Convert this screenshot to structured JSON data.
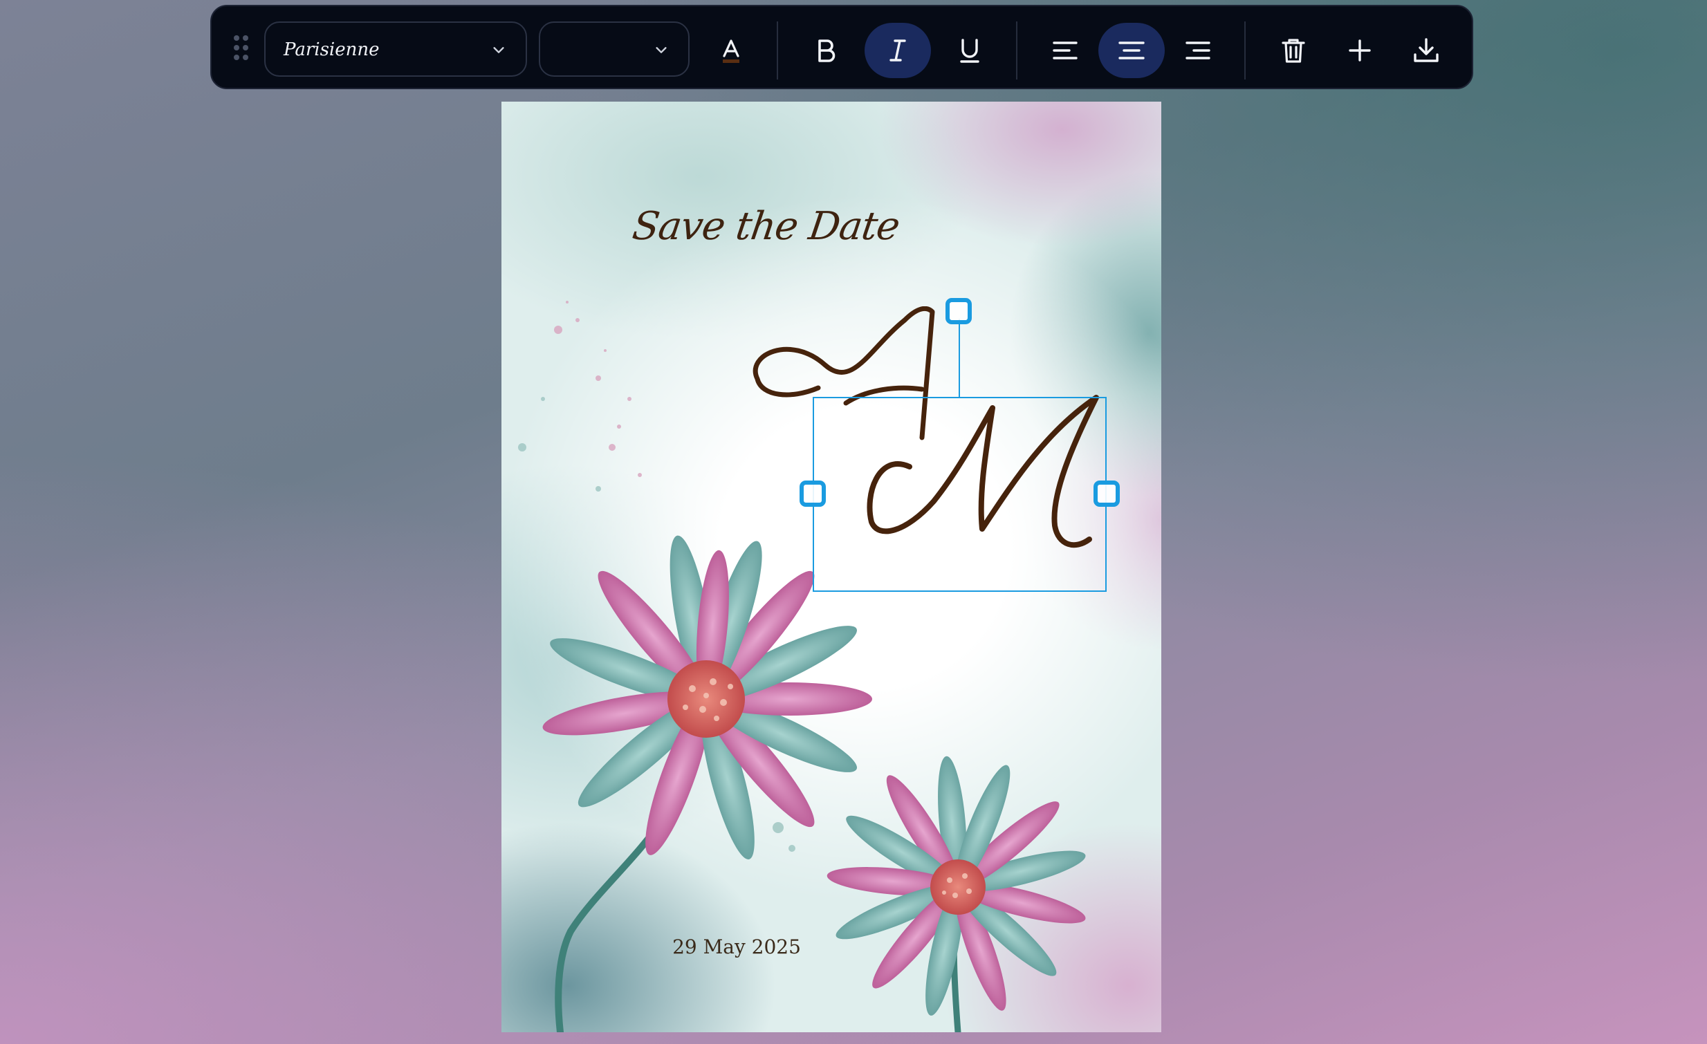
{
  "toolbar": {
    "font_family_value": "Parisienne",
    "font_size_value": "",
    "buttons": {
      "text_color": "text-color-icon",
      "bold": "bold-icon",
      "italic": "italic-icon",
      "underline": "underline-icon",
      "align_left": "align-left-icon",
      "align_center": "align-center-icon",
      "align_right": "align-right-icon",
      "delete": "trash-icon",
      "add": "plus-icon",
      "download": "download-icon"
    },
    "active": [
      "italic",
      "align_center"
    ],
    "text_color": "#5a2e12",
    "accent": "#1a2a5e"
  },
  "card": {
    "heading": "Save the Date",
    "monogram_first": "A",
    "monogram_second": "M",
    "date": "29 May 2025",
    "text_color": "#3e2310",
    "selection_color": "#1a9be0"
  }
}
